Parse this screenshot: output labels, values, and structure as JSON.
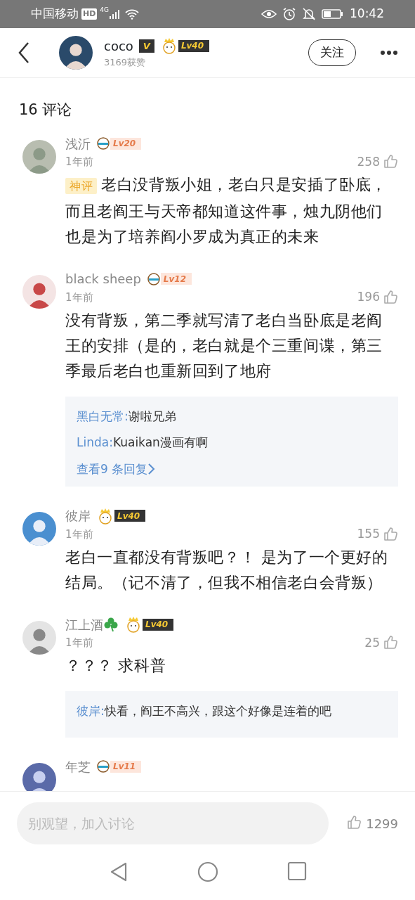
{
  "status_bar": {
    "carrier": "中国移动",
    "network": "HD",
    "signal_label": "4G",
    "time": "10:42"
  },
  "header": {
    "user": "coco",
    "verified": "V",
    "level": "Lv40",
    "crown": true,
    "likes": "3169获赞",
    "follow": "关注"
  },
  "comments_title": "16 评论",
  "comments": [
    {
      "author": "浅沂",
      "level": "Lv20",
      "crown": false,
      "time": "1年前",
      "likes": "258",
      "tag": "神评",
      "text": "老白没背叛小姐，老白只是安插了卧底，而且老阎王与天帝都知道这件事，烛九阴他们也是为了培养阎小罗成为真正的未来"
    },
    {
      "author": "black sheep",
      "level": "Lv12",
      "crown": false,
      "time": "1年前",
      "likes": "196",
      "text": "没有背叛，第二季就写清了老白当卧底是老阎王的安排（是的，老白就是个三重间谍，第三季最后老白也重新回到了地府",
      "replies": [
        {
          "author": "黑白无常:",
          "text": "谢啦兄弟"
        },
        {
          "author": "Linda:",
          "text": "Kuaikan漫画有啊"
        }
      ],
      "more_replies": "查看9 条回复"
    },
    {
      "author": "彼岸",
      "level": "Lv40",
      "crown": true,
      "time": "1年前",
      "likes": "155",
      "text": "老白一直都没有背叛吧？！ 是为了一个更好的结局。（记不清了，但我不相信老白会背叛）"
    },
    {
      "author": "江上酒",
      "clover": true,
      "level": "Lv40",
      "crown": true,
      "time": "1年前",
      "likes": "25",
      "text": "？？？ 求科普",
      "replies": [
        {
          "author": "彼岸:",
          "text": "快看，阎王不高兴，跟这个好像是连着的吧"
        }
      ]
    },
    {
      "author": "年芝",
      "level": "Lv11",
      "crown": false
    }
  ],
  "bottom_bar": {
    "placeholder": "别观望，加入讨论",
    "likes": "1299"
  }
}
